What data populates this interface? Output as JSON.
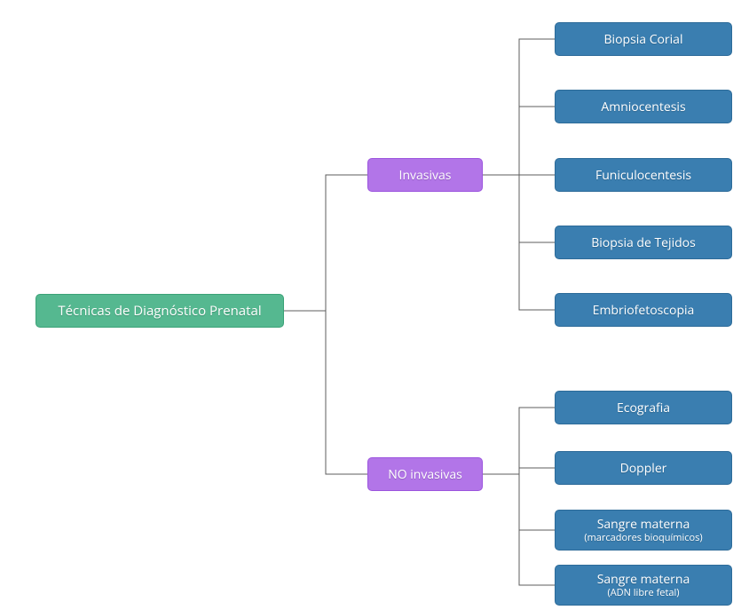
{
  "chart_data": {
    "type": "tree",
    "title": "Técnicas de Diagnóstico Prenatal",
    "root": {
      "label": "Técnicas de Diagnóstico Prenatal",
      "color": "#55b890",
      "children": [
        {
          "label": "Invasivas",
          "color": "#b275e8",
          "children": [
            {
              "label": "Biopsia Corial",
              "color": "#3a7eb0"
            },
            {
              "label": "Amniocentesis",
              "color": "#3a7eb0"
            },
            {
              "label": "Funiculocentesis",
              "color": "#3a7eb0"
            },
            {
              "label": "Biopsia de Tejidos",
              "color": "#3a7eb0"
            },
            {
              "label": "Embriofetoscopia",
              "color": "#3a7eb0"
            }
          ]
        },
        {
          "label": "NO invasivas",
          "color": "#b275e8",
          "children": [
            {
              "label": "Ecografia",
              "color": "#3a7eb0"
            },
            {
              "label": "Doppler",
              "color": "#3a7eb0"
            },
            {
              "label": "Sangre materna",
              "sublabel": "(marcadores bioquímicos)",
              "color": "#3a7eb0"
            },
            {
              "label": "Sangre materna",
              "sublabel": "(ADN libre fetal)",
              "color": "#3a7eb0"
            }
          ]
        }
      ]
    }
  },
  "root_label": "Técnicas de Diagnóstico Prenatal",
  "invasivas_label": "Invasivas",
  "no_invasivas_label": "NO invasivas",
  "leaf1": "Biopsia Corial",
  "leaf2": "Amniocentesis",
  "leaf3": "Funiculocentesis",
  "leaf4": "Biopsia de Tejidos",
  "leaf5": "Embriofetoscopia",
  "leaf6": "Ecografia",
  "leaf7": "Doppler",
  "leaf8": "Sangre materna",
  "leaf8_sub": "(marcadores bioquímicos)",
  "leaf9": "Sangre materna",
  "leaf9_sub": "(ADN libre fetal)"
}
